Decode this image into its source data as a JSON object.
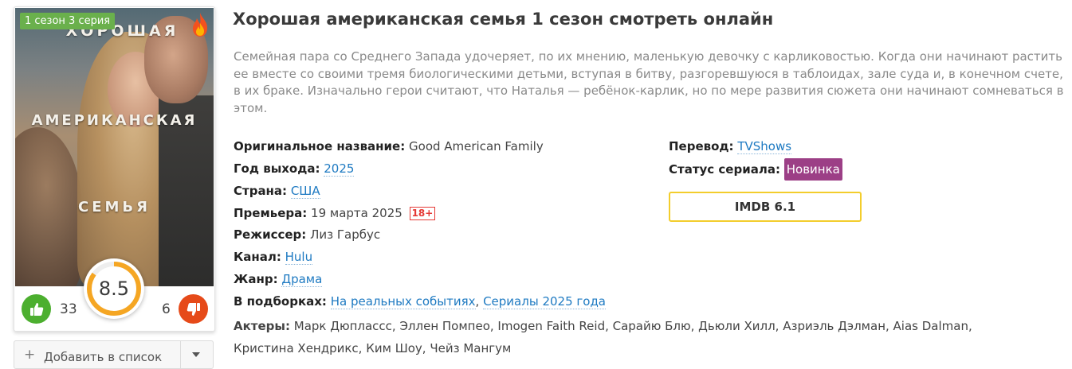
{
  "poster": {
    "season_badge": "1 сезон 3 серия",
    "title_line1": "ХОРОШАЯ",
    "title_line2": "АМЕРИКАНСКАЯ",
    "title_line3": "СЕМЬЯ",
    "fire_icon": "fire-icon"
  },
  "rating": {
    "value": "8.5",
    "score": 8.5,
    "max": 10,
    "ring_color": "#f5a623",
    "track_color": "#eeeeee"
  },
  "votes": {
    "likes": "33",
    "dislikes": "6",
    "like_icon": "thumbs-up-icon",
    "dislike_icon": "thumbs-down-icon",
    "like_color": "#4caf2f",
    "dislike_color": "#e64a19"
  },
  "add_list": {
    "label": "Добавить в список",
    "icon": "plus-icon",
    "menu_icon": "chevron-down-icon"
  },
  "page": {
    "title": "Хорошая американская семья 1 сезон смотреть онлайн",
    "description": "Семейная пара со Среднего Запада удочеряет, по их мнению, маленькую девочку с карликовостью. Когда они начинают растить ее вместе со своими тремя биологическими детьми, вступая в битву, разгоревшуюся в таблоидах, зале суда и, в конечном счете, в их браке. Изначально герои считают, что Наталья — ребёнок-карлик, но по мере развития сюжета они начинают сомневаться в этом."
  },
  "info": {
    "original_title": {
      "label": "Оригинальное название:",
      "value": "Good American Family"
    },
    "year": {
      "label": "Год выхода:",
      "value": "2025"
    },
    "country": {
      "label": "Страна:",
      "value": "США"
    },
    "premiere": {
      "label": "Премьера:",
      "value": "19 марта 2025",
      "age": "18+"
    },
    "director": {
      "label": "Режиссер:",
      "value": "Лиз Гарбус"
    },
    "channel": {
      "label": "Канал:",
      "value": "Hulu"
    },
    "genre": {
      "label": "Жанр:",
      "value": "Драма"
    },
    "collections": {
      "label": "В подборках:",
      "items": [
        "На реальных событиях",
        "Сериалы 2025 года"
      ],
      "separator": ", "
    },
    "actors": {
      "label": "Актеры:",
      "value": "Марк Дюплассс, Эллен Помпео, Imogen Faith Reid, Сарайю Блю, Дьюли Хилл, Азриэль Дэлман, Aias Dalman, Кристина Хендрикс, Ким Шоу, Чейз Мангум"
    }
  },
  "right": {
    "translation": {
      "label": "Перевод:",
      "value": "TVShows"
    },
    "status": {
      "label": "Статус сериала:",
      "value": "Новинка",
      "color": "#9c3f86"
    },
    "imdb": "IMDB 6.1"
  }
}
